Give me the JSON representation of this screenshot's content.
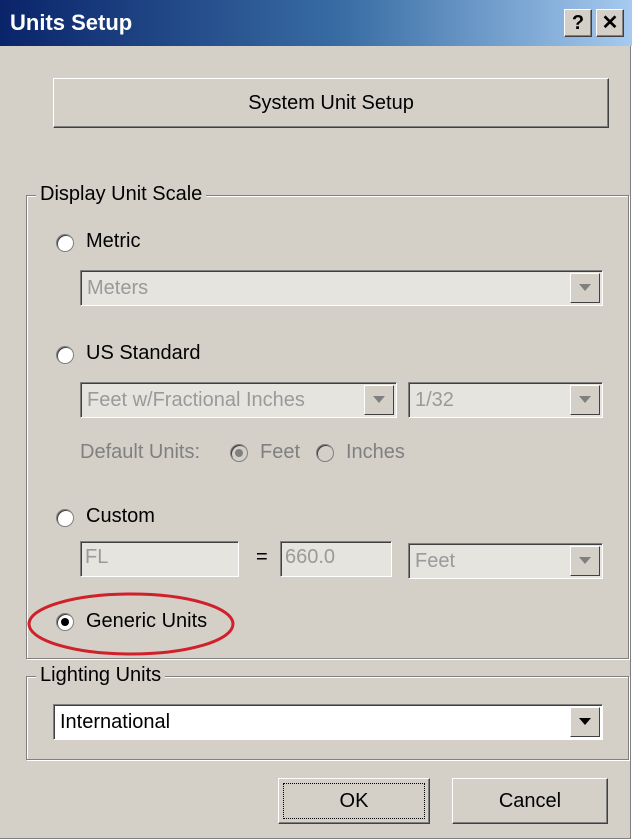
{
  "window": {
    "title": "Units Setup",
    "help_glyph": "?",
    "close_glyph": "✕"
  },
  "system_unit_button": "System Unit Setup",
  "display_unit_scale": {
    "legend": "Display Unit Scale",
    "metric": {
      "label": "Metric",
      "selected": false,
      "unit_value": "Meters"
    },
    "us_standard": {
      "label": "US Standard",
      "selected": false,
      "unit_value": "Feet w/Fractional Inches",
      "fraction_value": "1/32",
      "default_units_label": "Default Units:",
      "feet_label": "Feet",
      "inches_label": "Inches",
      "default_selected": "Feet"
    },
    "custom": {
      "label": "Custom",
      "selected": false,
      "name_value": "FL",
      "equals": "=",
      "amount_value": "660.0",
      "unit_value": "Feet"
    },
    "generic": {
      "label": "Generic Units",
      "selected": true
    }
  },
  "lighting_units": {
    "legend": "Lighting Units",
    "value": "International"
  },
  "buttons": {
    "ok": "OK",
    "cancel": "Cancel"
  },
  "annotation": {
    "highlight_color": "#d0202a",
    "highlights": "generic-units"
  }
}
